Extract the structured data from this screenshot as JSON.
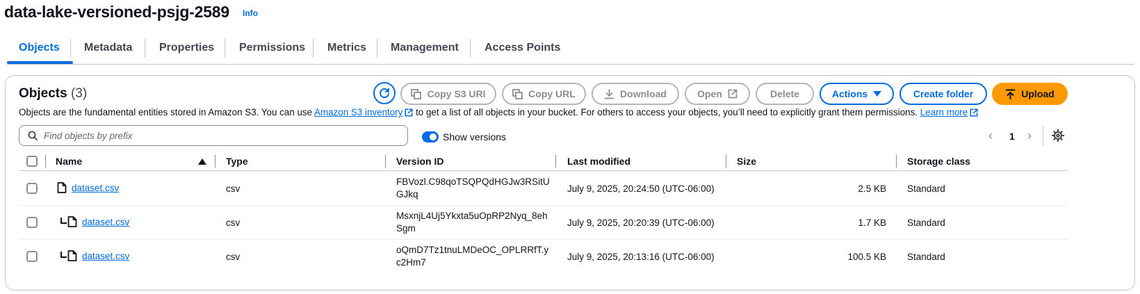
{
  "header": {
    "bucket_name": "data-lake-versioned-psjg-2589",
    "info_label": "Info"
  },
  "tabs": [
    {
      "label": "Objects",
      "active": true
    },
    {
      "label": "Metadata"
    },
    {
      "label": "Properties"
    },
    {
      "label": "Permissions"
    },
    {
      "label": "Metrics"
    },
    {
      "label": "Management"
    },
    {
      "label": "Access Points"
    }
  ],
  "objects_panel": {
    "title": "Objects",
    "count": "(3)",
    "buttons": {
      "copy_s3_uri": "Copy S3 URI",
      "copy_url": "Copy URL",
      "download": "Download",
      "open": "Open",
      "delete": "Delete",
      "actions": "Actions",
      "create_folder": "Create folder",
      "upload": "Upload"
    },
    "description": {
      "part1": "Objects are the fundamental entities stored in Amazon S3. You can use ",
      "inventory_link": "Amazon S3 inventory",
      "part2": " to get a list of all objects in your bucket. For others to access your objects, you’ll need to explicitly grant them permissions. ",
      "learn_more": "Learn more"
    },
    "search": {
      "placeholder": "Find objects by prefix",
      "value": ""
    },
    "show_versions": {
      "label": "Show versions",
      "enabled": true
    },
    "pagination": {
      "page": "1"
    }
  },
  "table": {
    "columns": [
      "Name",
      "Type",
      "Version ID",
      "Last modified",
      "Size",
      "Storage class"
    ],
    "sort_column": "Name",
    "rows": [
      {
        "name": "dataset.csv",
        "type": "csv",
        "version_id": "FBVozl.C98qoTSQPQdHGJw3RSitUGJkq",
        "last_modified": "July 9, 2025, 20:24:50 (UTC-06:00)",
        "size": "2.5 KB",
        "storage_class": "Standard"
      },
      {
        "name": "dataset.csv",
        "type": "csv",
        "version_id": "MsxnjL4Uj5Ykxta5uOpRP2Nyq_8ehSgm",
        "last_modified": "July 9, 2025, 20:20:39 (UTC-06:00)",
        "size": "1.7 KB",
        "storage_class": "Standard"
      },
      {
        "name": "dataset.csv",
        "type": "csv",
        "version_id": "oQmD7Tz1tnuLMDeOC_OPLRRfT.yc2Hm7",
        "last_modified": "July 9, 2025, 20:13:16 (UTC-06:00)",
        "size": "100.5 KB",
        "storage_class": "Standard"
      }
    ]
  },
  "colors": {
    "accent": "#006ce0",
    "upload": "#ff9900",
    "border": "#c6c6cd",
    "text": "#0f141a"
  }
}
